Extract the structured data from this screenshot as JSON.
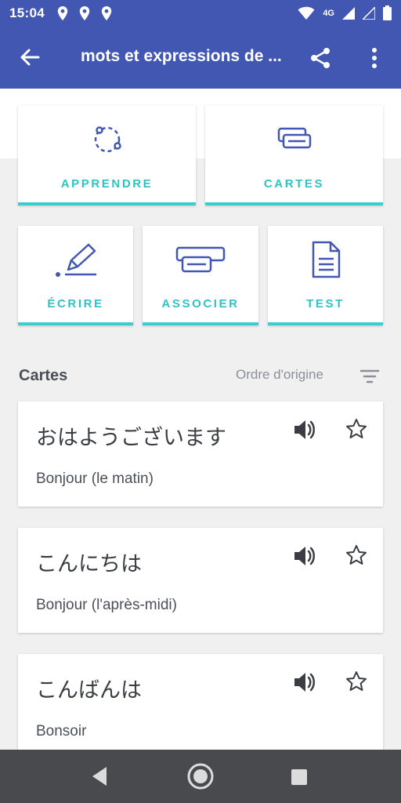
{
  "status_bar": {
    "time": "15:04",
    "network": "4G",
    "icons": [
      "location-pin-icon",
      "location-pin-icon",
      "location-pin-icon",
      "wifi-icon",
      "signal-icon",
      "signal-icon",
      "battery-icon"
    ]
  },
  "app_bar": {
    "title": "mots et expressions de ...",
    "back_icon": "arrow-left-icon",
    "share_icon": "share-icon",
    "more_icon": "more-vert-icon",
    "color": "#4257b2"
  },
  "modes": [
    {
      "label": "APPRENDRE",
      "icon": "learn-icon"
    },
    {
      "label": "CARTES",
      "icon": "cards-icon"
    },
    {
      "label": "ÉCRIRE",
      "icon": "write-icon"
    },
    {
      "label": "ASSOCIER",
      "icon": "match-icon"
    },
    {
      "label": "TEST",
      "icon": "test-icon"
    }
  ],
  "accent_color": "#3ccbcf",
  "section": {
    "title": "Cartes",
    "sort_label": "Ordre d'origine",
    "sort_icon": "sort-icon"
  },
  "cards": [
    {
      "term": "おはようございます",
      "definition": "Bonjour (le matin)"
    },
    {
      "term": "こんにちは",
      "definition": "Bonjour (l'après-midi)"
    },
    {
      "term": "こんばんは",
      "definition": "Bonsoir"
    }
  ],
  "nav_bar": {
    "icons": [
      "nav-back-icon",
      "nav-home-icon",
      "nav-recent-icon"
    ]
  }
}
